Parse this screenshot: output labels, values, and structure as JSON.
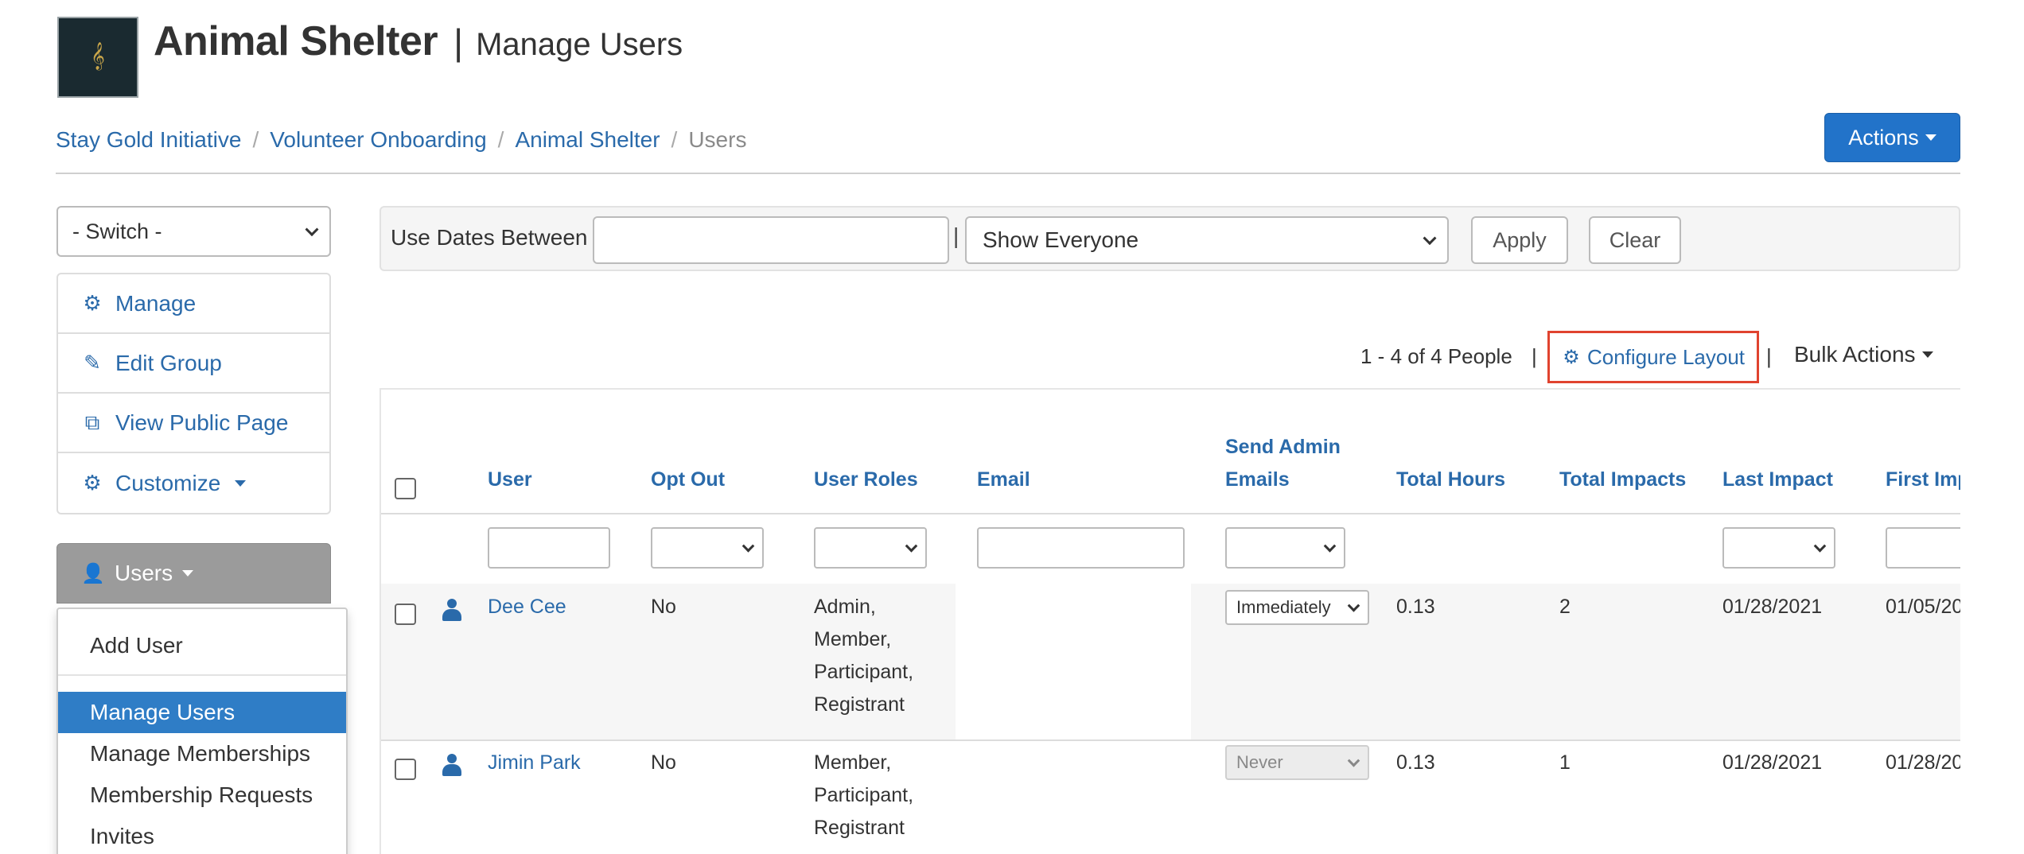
{
  "header": {
    "org_name": "Animal Shelter",
    "separator": "|",
    "page_name": "Manage Users",
    "logo_icon": "treble-clef-logo",
    "actions_label": "Actions"
  },
  "breadcrumb": {
    "items": [
      "Stay Gold Initiative",
      "Volunteer Onboarding",
      "Animal Shelter"
    ],
    "current": "Users",
    "separator": "/"
  },
  "sidebar": {
    "switch_value": "- Switch -",
    "menu": [
      {
        "label": "Manage",
        "icon": "gears-icon"
      },
      {
        "label": "Edit Group",
        "icon": "pencil-icon"
      },
      {
        "label": "View Public Page",
        "icon": "external-link-icon"
      },
      {
        "label": "Customize",
        "icon": "gears-icon"
      }
    ],
    "users_button": "Users",
    "dropdown": [
      "Add User",
      "Manage Users",
      "Manage Memberships",
      "Membership Requests",
      "Invites"
    ],
    "dropdown_active": "Manage Users"
  },
  "filters": {
    "label": "Use Dates Between",
    "date_value": "",
    "pipe": "|",
    "show_value": "Show Everyone",
    "apply_label": "Apply",
    "clear_label": "Clear"
  },
  "toolbar": {
    "results": "1 - 4 of 4 People",
    "pipe": "|",
    "configure_label": "Configure Layout",
    "bulk_label": "Bulk Actions"
  },
  "table": {
    "columns": [
      "User",
      "Opt Out",
      "User Roles",
      "Email",
      "Send Admin",
      "Emails",
      "Total Hours",
      "Total Impacts",
      "Last Impact",
      "First Imp"
    ],
    "rows": [
      {
        "user": "Dee Cee",
        "opt_out": "No",
        "roles": [
          "Admin,",
          "Member,",
          "Participant,",
          "Registrant"
        ],
        "send_admin": "Immediately",
        "total_hours": "0.13",
        "total_impacts": "2",
        "last_impact": "01/28/2021",
        "first_impact": "01/05/20"
      },
      {
        "user": "Jimin Park",
        "opt_out": "No",
        "roles": [
          "Member,",
          "Participant,",
          "Registrant"
        ],
        "send_admin": "Never",
        "total_hours": "0.13",
        "total_impacts": "1",
        "last_impact": "01/28/2021",
        "first_impact": "01/28/20"
      }
    ]
  },
  "colors": {
    "link": "#2a6aaa",
    "primary_button": "#2273c9",
    "active_item": "#2f7dc6",
    "highlight_border": "#e0432f"
  }
}
